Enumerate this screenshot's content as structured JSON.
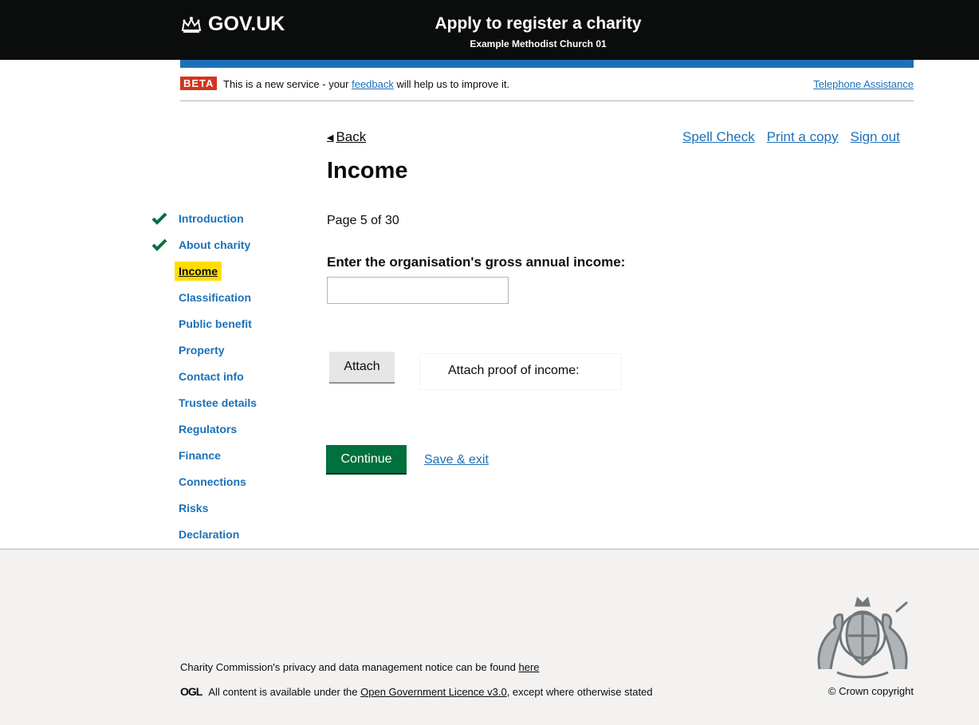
{
  "header": {
    "logo_text": "GOV.UK",
    "service_title": "Apply to register a charity",
    "service_subtitle": "Example Methodist Church 01"
  },
  "beta": {
    "tag": "BETA",
    "text_before": "This is a new service - your ",
    "feedback_link": "feedback",
    "text_after": " will help us to improve it.",
    "telephone_link": "Telephone Assistance"
  },
  "toplinks": {
    "back": "Back",
    "spell_check": "Spell Check",
    "print": "Print a copy",
    "sign_out": "Sign out"
  },
  "page": {
    "title": "Income",
    "page_count": "Page 5 of 30",
    "question": "Enter the organisation's gross annual income:",
    "income_value": "",
    "attach_button": "Attach",
    "attach_label": "Attach proof of income:",
    "continue_button": "Continue",
    "save_exit": "Save & exit"
  },
  "nav": {
    "items": [
      {
        "label": "Introduction",
        "completed": true
      },
      {
        "label": "About charity",
        "completed": true
      },
      {
        "label": "Income",
        "current": true
      },
      {
        "label": "Classification"
      },
      {
        "label": "Public benefit"
      },
      {
        "label": "Property"
      },
      {
        "label": "Contact info"
      },
      {
        "label": "Trustee details"
      },
      {
        "label": "Regulators"
      },
      {
        "label": "Finance"
      },
      {
        "label": "Connections"
      },
      {
        "label": "Risks"
      },
      {
        "label": "Declaration"
      }
    ]
  },
  "footer": {
    "privacy_text": "Charity Commission's privacy and data management notice can be found ",
    "privacy_link": "here",
    "ogl_logo": "OGL",
    "licence_before": "All content is available under the ",
    "licence_link": "Open Government Licence v3.0",
    "licence_after": ", except where otherwise stated",
    "copyright": "© Crown copyright"
  },
  "colors": {
    "header_bg": "#0b0c0c",
    "link": "#1d70b8",
    "beta_tag": "#d4351c",
    "continue_button": "#00703c",
    "current_highlight": "#ffdd00",
    "check": "#00703c"
  },
  "icons": {
    "logo": "crown-icon",
    "back": "back-arrow-icon",
    "completed": "check-icon",
    "crest": "royal-coat-of-arms"
  }
}
